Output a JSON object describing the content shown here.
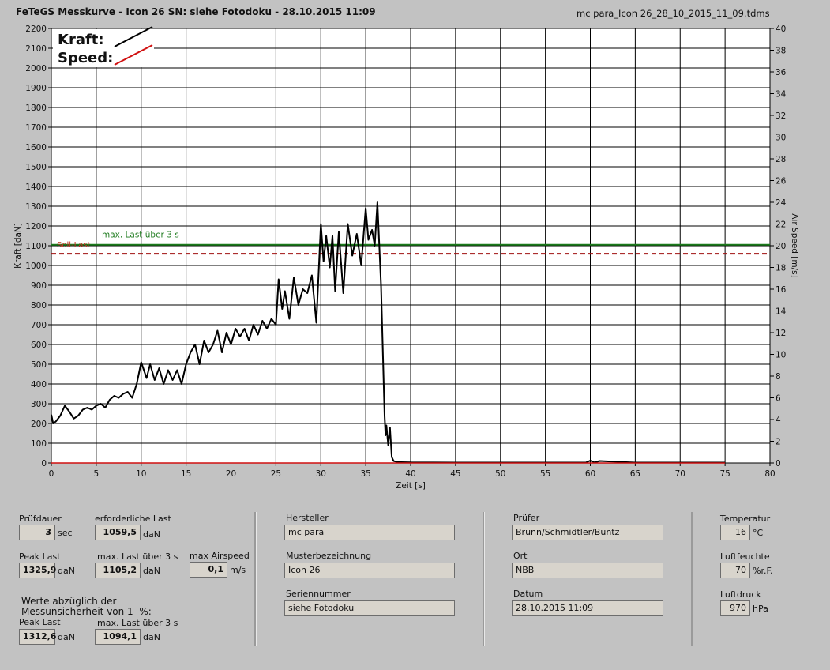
{
  "header": {
    "title": "FeTeGS Messkurve - Icon 26  SN: siehe Fotodoku - 28.10.2015 11:09",
    "filename": "mc para_Icon 26_28_10_2015_11_09.tdms"
  },
  "chart_data": {
    "type": "line",
    "xlabel": "Zeit [s]",
    "ylabel": "Kraft [daN]",
    "y2label": "Air Speed [m/s]",
    "xlim": [
      0,
      80
    ],
    "ylim": [
      0,
      2200
    ],
    "y2lim": [
      0,
      40
    ],
    "x_ticks": [
      "0",
      "5",
      "10",
      "15",
      "20",
      "25",
      "30",
      "35",
      "40",
      "45",
      "50",
      "55",
      "60",
      "65",
      "70",
      "75",
      "80"
    ],
    "y_ticks": [
      "0",
      "100",
      "200",
      "300",
      "400",
      "500",
      "600",
      "700",
      "800",
      "900",
      "1000",
      "1100",
      "1200",
      "1300",
      "1400",
      "1500",
      "1600",
      "1700",
      "1800",
      "1900",
      "2000",
      "2100",
      "2200"
    ],
    "y2_ticks": [
      "0",
      "2",
      "4",
      "6",
      "8",
      "10",
      "12",
      "14",
      "16",
      "18",
      "20",
      "22",
      "24",
      "26",
      "28",
      "30",
      "32",
      "34",
      "36",
      "38",
      "40"
    ],
    "grid": true,
    "legend": {
      "position": "top-left",
      "entries": [
        {
          "label": "Kraft:",
          "color": "#000000"
        },
        {
          "label": "Speed:",
          "color": "#d01010"
        }
      ]
    },
    "reference_lines": [
      {
        "label": "max. Last über  3 s",
        "value": 1105.2,
        "color": "#1c7a1c",
        "style": "solid"
      },
      {
        "label": "Soll-Last",
        "value": 1059.5,
        "color": "#a01010",
        "style": "dashed"
      }
    ],
    "series": [
      {
        "name": "Kraft",
        "color": "#000000",
        "x": [
          0,
          0.2,
          0.5,
          1,
          1.5,
          2,
          2.5,
          3,
          3.5,
          4,
          4.5,
          5,
          5.5,
          6,
          6.5,
          7,
          7.5,
          8,
          8.5,
          9,
          9.5,
          10,
          10.3,
          10.6,
          11,
          11.5,
          12,
          12.5,
          13,
          13.5,
          14,
          14.5,
          15,
          15.5,
          16,
          16.5,
          17,
          17.5,
          18,
          18.5,
          19,
          19.5,
          20,
          20.5,
          21,
          21.5,
          22,
          22.5,
          23,
          23.5,
          24,
          24.5,
          25,
          25.3,
          25.7,
          26,
          26.5,
          27,
          27.5,
          28,
          28.5,
          29,
          29.5,
          30,
          30.3,
          30.6,
          31,
          31.3,
          31.6,
          32,
          32.5,
          33,
          33.5,
          34,
          34.5,
          35,
          35.3,
          35.7,
          36,
          36.3,
          36.7,
          37,
          37.1,
          37.2,
          37.3,
          37.5,
          37.7,
          37.9,
          38.1,
          38.5,
          40,
          45,
          50,
          55,
          59.5,
          60,
          60.5,
          61,
          65,
          70,
          75
        ],
        "y": [
          245,
          200,
          210,
          240,
          290,
          260,
          225,
          240,
          270,
          280,
          270,
          290,
          300,
          280,
          320,
          340,
          330,
          350,
          360,
          330,
          400,
          510,
          470,
          430,
          500,
          420,
          480,
          400,
          470,
          420,
          470,
          400,
          500,
          560,
          600,
          500,
          620,
          560,
          600,
          670,
          560,
          660,
          600,
          680,
          640,
          680,
          620,
          700,
          650,
          720,
          680,
          730,
          700,
          930,
          780,
          870,
          730,
          940,
          800,
          880,
          860,
          950,
          710,
          1210,
          1020,
          1150,
          990,
          1150,
          870,
          1170,
          860,
          1210,
          1050,
          1160,
          1000,
          1290,
          1130,
          1180,
          1100,
          1320,
          900,
          400,
          240,
          140,
          190,
          90,
          180,
          30,
          10,
          5,
          3,
          2,
          2,
          2,
          2,
          12,
          2,
          10,
          2,
          2,
          2
        ]
      },
      {
        "name": "Speed",
        "color": "#d01010",
        "x": [
          0,
          75
        ],
        "y": [
          0,
          0
        ]
      }
    ]
  },
  "panel": {
    "pruefdauer": {
      "label": "Prüfdauer",
      "value": "3",
      "unit": "sec"
    },
    "erforderliche_last": {
      "label": "erforderliche Last",
      "value": "1059,5",
      "unit": "daN"
    },
    "peak_last": {
      "label": "Peak Last",
      "value": "1325,9",
      "unit": "daN"
    },
    "max_last": {
      "label": "max. Last über  3 s",
      "value": "1105,2",
      "unit": "daN"
    },
    "max_airspeed": {
      "label": "max Airspeed",
      "value": "0,1",
      "unit": "m/s"
    },
    "werte_note": "Werte abzüglich der\nMessunsicherheit von 1  %:",
    "peak_last_corr": {
      "label": "Peak Last",
      "value": "1312,6",
      "unit": "daN"
    },
    "max_last_corr": {
      "label": "max. Last über  3 s",
      "value": "1094,1",
      "unit": "daN"
    },
    "hersteller": {
      "label": "Hersteller",
      "value": "mc para"
    },
    "musterbezeichnung": {
      "label": "Musterbezeichnung",
      "value": "Icon 26"
    },
    "seriennummer": {
      "label": "Seriennummer",
      "value": "siehe Fotodoku"
    },
    "pruefer": {
      "label": "Prüfer",
      "value": "Brunn/Schmidtler/Buntz"
    },
    "ort": {
      "label": "Ort",
      "value": "NBB"
    },
    "datum": {
      "label": "Datum",
      "value": "28.10.2015 11:09"
    },
    "temperatur": {
      "label": "Temperatur",
      "value": "16",
      "unit": "°C"
    },
    "luftfeuchte": {
      "label": "Luftfeuchte",
      "value": "70",
      "unit": "%r.F."
    },
    "luftdruck": {
      "label": "Luftdruck",
      "value": "970",
      "unit": "hPa"
    }
  }
}
